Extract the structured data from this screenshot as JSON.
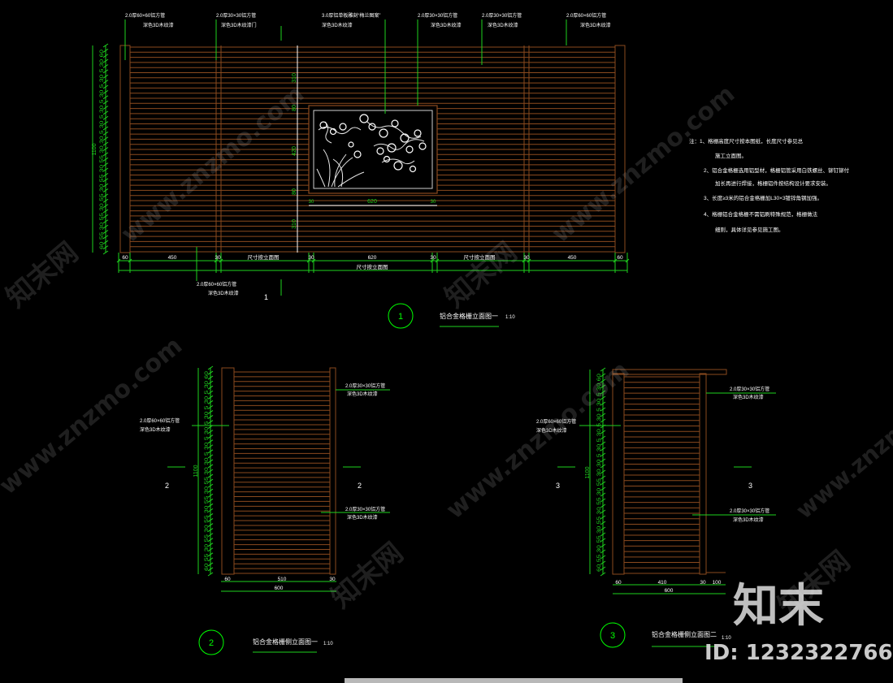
{
  "colors": {
    "background": "#000000",
    "slat": "#8a4a1e",
    "slat_light": "#a05a28",
    "dim": "#1ed21e",
    "text": "#ffffff",
    "circle": "#00ff00",
    "screen_frame": "#8a4a1e"
  },
  "elevation1": {
    "labels": [
      {
        "l1": "2.0厚60×60铝方管",
        "l2": "深色3D木纹漆"
      },
      {
        "l1": "2.0厚30×30铝方管",
        "l2": "深色3D木纹漆门"
      },
      {
        "l1": "3.0厚铝单板雕刻“梅兰图案”",
        "l2": "深色3D木纹漆"
      },
      {
        "l1": "2.0厚30×30铝方管",
        "l2": "深色3D木纹漆"
      },
      {
        "l1": "2.0厚30×30铝方管",
        "l2": "深色3D木纹漆"
      },
      {
        "l1": "2.0厚60×60铝方管",
        "l2": "深色3D木纹漆"
      }
    ],
    "bottom_label": {
      "l1": "2.0厚60×60铝方管",
      "l2": "深色3D木纹漆"
    },
    "height_total": "1100",
    "left_dims": "60 55 30 55 30 55 30 55 30 55 30 30 5 30 5 30 5 30 5 30 5 30 60",
    "center_vdims": [
      "310",
      "80",
      "420",
      "80",
      "310"
    ],
    "screen_width": "620",
    "screen_side_dims": [
      "30",
      "30"
    ],
    "bottom_dims": [
      "60",
      "450",
      "30",
      "尺寸按立面图",
      "30",
      "620",
      "30",
      "尺寸按立面图",
      "30",
      "450",
      "60"
    ],
    "bottom_total": "尺寸按立面图",
    "section_mark": "1",
    "title": "铝合金格栅立面图一",
    "scale": "1:10"
  },
  "notes": [
    "注：1、格栅高度尺寸按本图纸，长度尺寸参见总",
    "施工立面图。",
    "2、铝合金格栅选用铝型材，格栅铝管采用白铁螺丝、铆钉铆付",
    "加长再进行焊接，格栅铝件按结构设计要求安装。",
    "3、长度≥3米的铝合金格栅加L30×3镀锌角钢加强。",
    "4、格栅铝合金格栅不需铝刷特殊规范，格栅做法",
    "细则，具体详见参见施工图。"
  ],
  "elevation2": {
    "labels": [
      {
        "l1": "2.0厚30×30铝方管",
        "l2": "深色3D木纹漆"
      },
      {
        "l1": "2.0厚60×60铝方管",
        "l2": "深色3D木纹漆"
      },
      {
        "l1": "2.0厚30×30铝方管",
        "l2": "深色3D木纹漆"
      }
    ],
    "height_total": "1100",
    "bottom_dims": [
      "60",
      "510",
      "30"
    ],
    "bottom_total": "600",
    "section_marks": [
      "2",
      "2"
    ],
    "number": "2",
    "title": "铝合金格栅侧立面图一",
    "scale": "1:10"
  },
  "elevation3": {
    "labels": [
      {
        "l1": "2.0厚30×30铝方管",
        "l2": "深色3D木纹漆"
      },
      {
        "l1": "2.0厚60×60铝方管",
        "l2": "深色3D木纹漆"
      },
      {
        "l1": "2.0厚30×30铝方管",
        "l2": "深色3D木纹漆"
      }
    ],
    "height_total": "1100",
    "bottom_dims": [
      "60",
      "410",
      "30",
      "100"
    ],
    "bottom_total": "600",
    "section_marks": [
      "3",
      "3"
    ],
    "number": "3",
    "title": "铝合金格栅侧立面图二",
    "scale": "1:10"
  },
  "watermarks": {
    "site": "www.znzmo.com",
    "brand": "知末网",
    "logo": "知末",
    "id": "ID: 1232322766"
  }
}
